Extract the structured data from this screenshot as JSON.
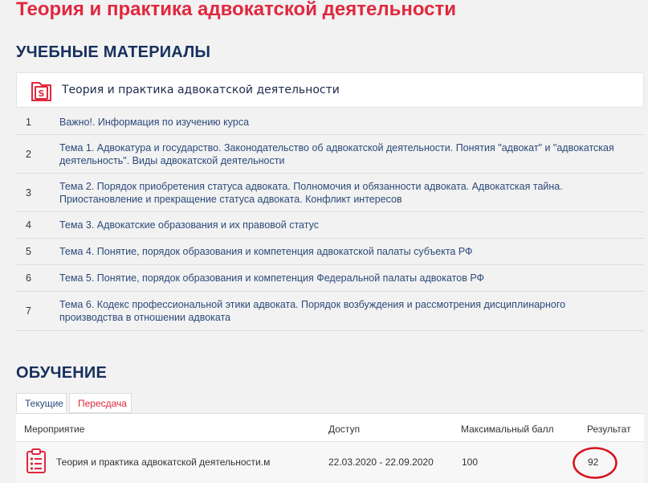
{
  "page": {
    "title": "Теория и практика адвокатской деятельности"
  },
  "materials": {
    "heading": "УЧЕБНЫЕ МАТЕРИАЛЫ",
    "course_title": "Теория и практика адвокатской деятельности",
    "items": [
      {
        "num": "1",
        "text": "Важно!. Информация по изучению курса"
      },
      {
        "num": "2",
        "text": "Тема 1. Адвокатура и государство. Законодательство об адвокатской деятельности. Понятия \"адвокат\" и \"адвокатская деятельность\". Виды адвокатской деятельности"
      },
      {
        "num": "3",
        "text": "Тема 2. Порядок приобретения статуса адвоката. Полномочия и обязанности адвоката. Адвокатская тайна. Приостановление и прекращение статуса адвоката. Конфликт интересов"
      },
      {
        "num": "4",
        "text": "Тема 3. Адвокатские образования и их правовой статус"
      },
      {
        "num": "5",
        "text": "Тема 4. Понятие, порядок образования и компетенция адвокатской палаты субъекта РФ"
      },
      {
        "num": "6",
        "text": "Тема 5. Понятие, порядок образования и компетенция Федеральной палаты адвокатов РФ"
      },
      {
        "num": "7",
        "text": "Тема 6. Кодекс профессиональной этики адвоката. Порядок возбуждения и рассмотрения дисциплинарного производства в отношении адвоката"
      }
    ]
  },
  "training": {
    "heading": "ОБУЧЕНИЕ",
    "tabs": [
      {
        "label": "Текущие",
        "active": true
      },
      {
        "label": "Пересдача",
        "active": false
      }
    ],
    "columns": {
      "event": "Мероприятие",
      "access": "Доступ",
      "max_score": "Максимальный балл",
      "result": "Результат"
    },
    "rows": [
      {
        "event": "Теория и практика адвокатской деятельности.м",
        "access": "22.03.2020 - 22.09.2020",
        "max_score": "100",
        "result": "92"
      }
    ]
  },
  "icons": {
    "course": "document-s-icon",
    "row": "clipboard-list-icon"
  },
  "colors": {
    "accent_red": "#e0283e",
    "navy": "#17305e",
    "link": "#2c4a7a",
    "annotation_red": "#d8121c"
  }
}
